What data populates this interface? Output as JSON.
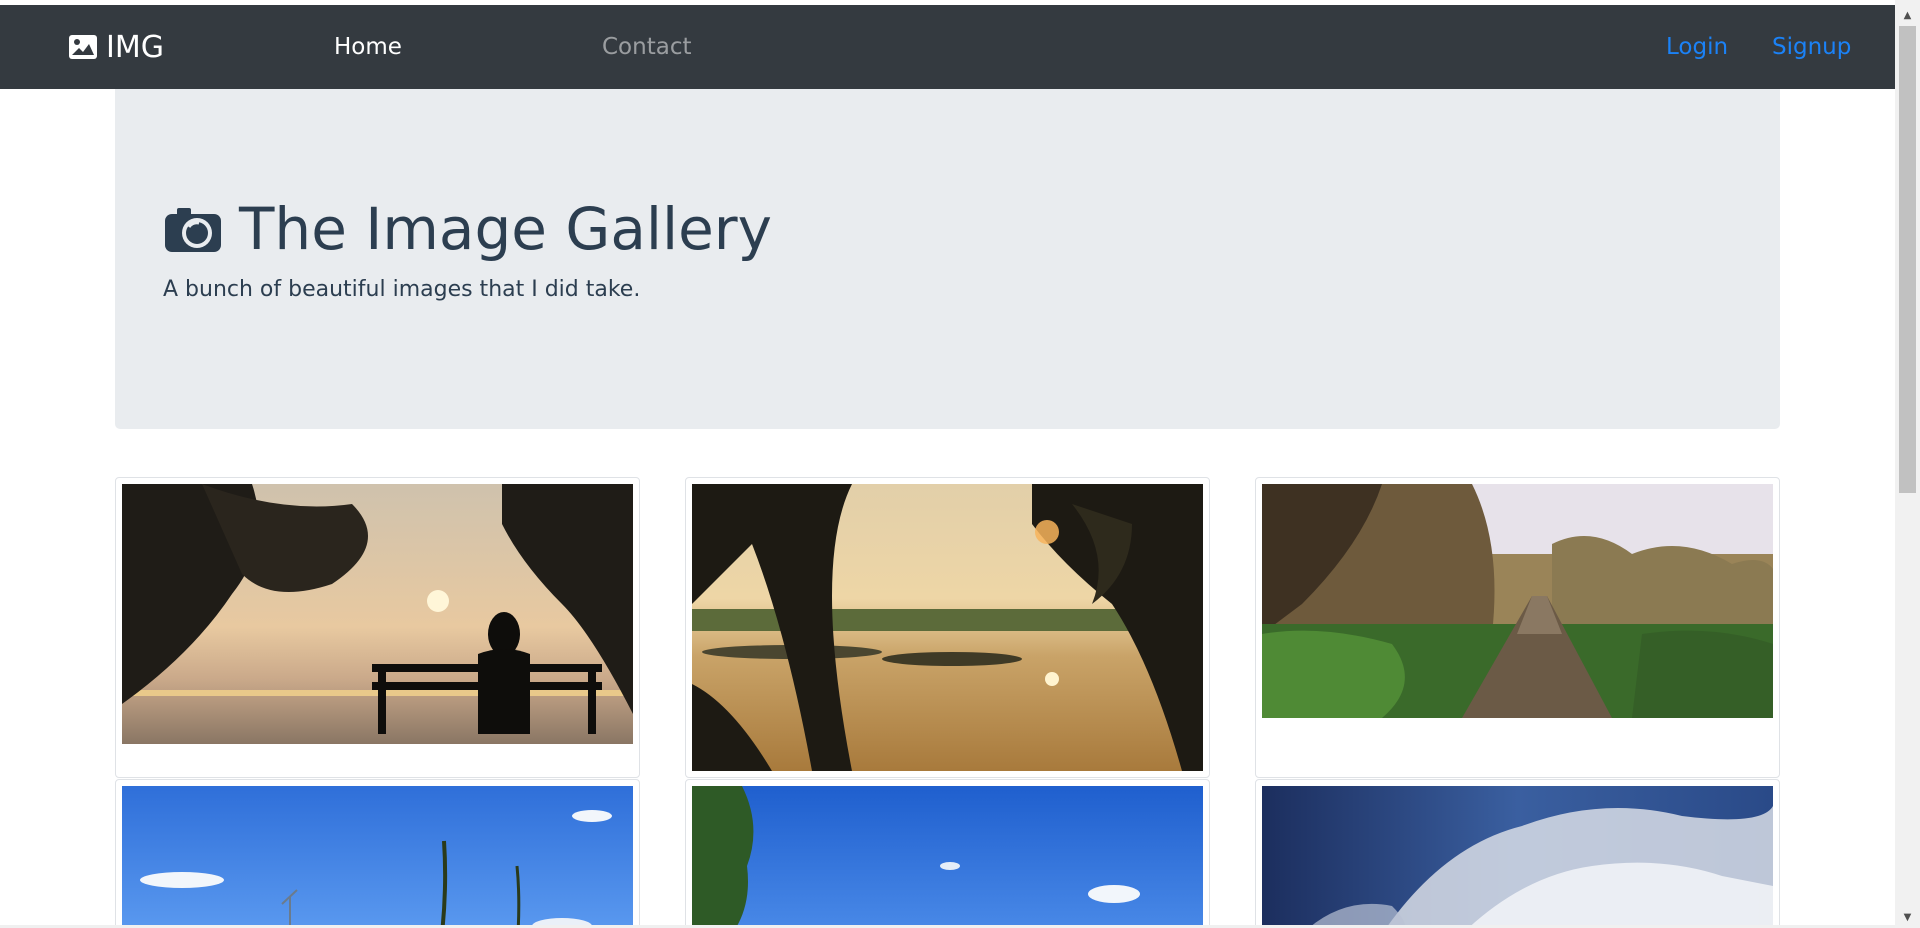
{
  "navbar": {
    "brand": {
      "icon": "image-icon",
      "label": "IMG"
    },
    "links": [
      {
        "label": "Home",
        "state": "active"
      },
      {
        "label": "Contact",
        "state": "inactive"
      }
    ],
    "auth": [
      {
        "label": "Login"
      },
      {
        "label": "Signup"
      }
    ],
    "colors": {
      "background": "#343a40",
      "link_active": "#ffffff",
      "link_auth": "#1b82f7"
    }
  },
  "jumbotron": {
    "icon": "camera-icon",
    "title": "The Image Gallery",
    "subtitle": "A bunch of beautiful images that I did take.",
    "colors": {
      "background": "#e9ecef",
      "text": "#2c3e50"
    }
  },
  "gallery": {
    "images": [
      {
        "scene": "sunset-bench-silhouette"
      },
      {
        "scene": "sunset-lake-trees"
      },
      {
        "scene": "wooden-boardwalk-path"
      },
      {
        "scene": "blue-sky-grass"
      },
      {
        "scene": "blue-sky-tree"
      },
      {
        "scene": "dramatic-clouds"
      }
    ]
  }
}
